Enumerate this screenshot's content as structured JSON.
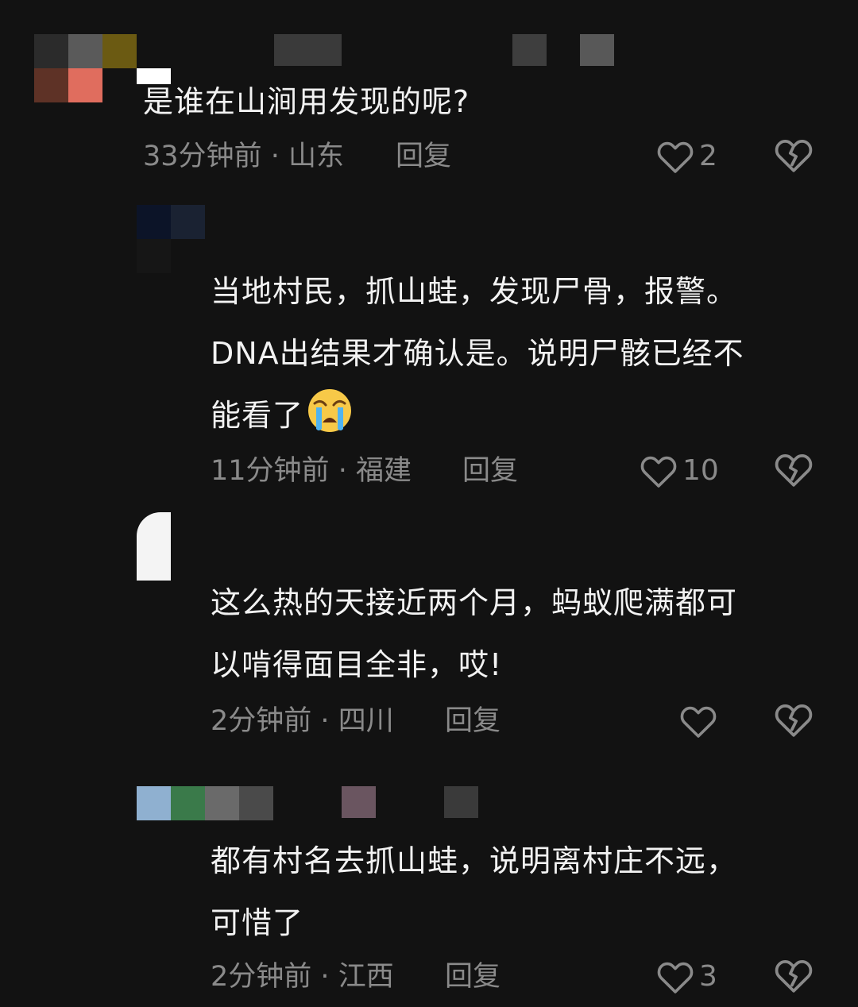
{
  "comments": [
    {
      "text": "是谁在山涧用发现的呢?",
      "time": "33分钟前",
      "sep": "·",
      "location": "山东",
      "reply": "回复",
      "likes": "2"
    },
    {
      "text": "当地村民，抓山蛙，发现尸骨，报警。\nDNA出结果才确认是。说明尸骸已经不\n能看了",
      "emoji": "crying-face-icon",
      "time": "11分钟前",
      "sep": "·",
      "location": "福建",
      "reply": "回复",
      "likes": "10"
    },
    {
      "text": "这么热的天接近两个月，蚂蚁爬满都可\n以啃得面目全非，哎!",
      "time": "2分钟前",
      "sep": "·",
      "location": "四川",
      "reply": "回复",
      "likes": ""
    },
    {
      "text": "都有村名去抓山蛙，说明离村庄不远，\n可惜了",
      "time": "2分钟前",
      "sep": "·",
      "location": "江西",
      "reply": "回复",
      "likes": "3"
    }
  ],
  "colors": {
    "background": "#121212",
    "text": "#f2f2f2",
    "muted": "#8a8a8a"
  },
  "icons": {
    "like": "heart-outline-icon",
    "dislike": "broken-heart-icon"
  }
}
